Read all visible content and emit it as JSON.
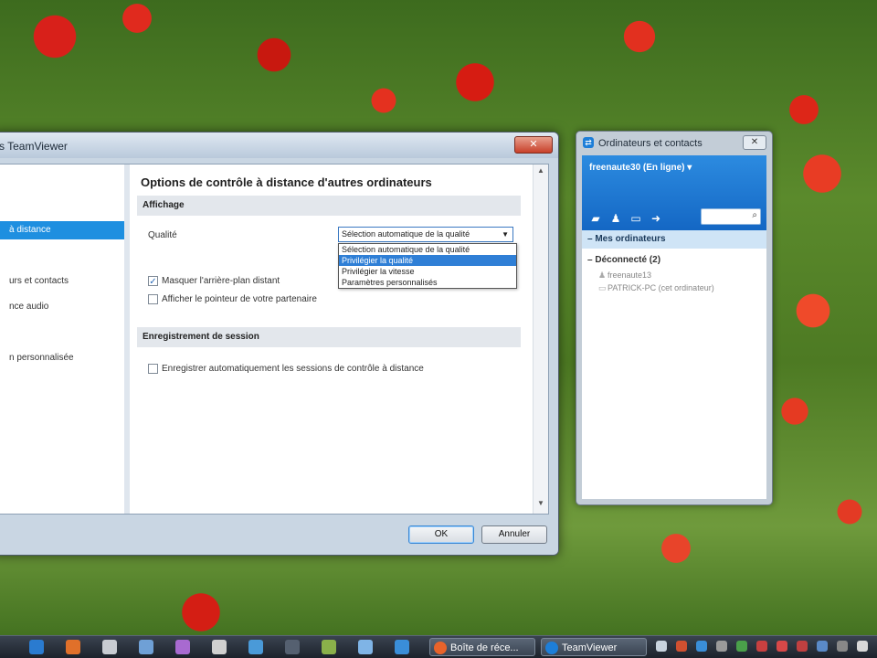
{
  "main_window": {
    "title": "s TeamViewer",
    "close_label": "✕",
    "nav": [
      {
        "label": "à distance",
        "selected": true
      },
      {
        "label": "urs et contacts",
        "selected": false
      },
      {
        "label": "nce audio",
        "selected": false
      },
      {
        "label": "n personnalisée",
        "selected": false
      }
    ],
    "page_title": "Options de contrôle à distance d'autres ordinateurs",
    "display_section": {
      "header": "Affichage",
      "quality_label": "Qualité",
      "quality_selected": "Sélection automatique de la qualité",
      "quality_options": [
        "Sélection automatique de la qualité",
        "Privilégier la qualité",
        "Privilégier la vitesse",
        "Paramètres personnalisés"
      ],
      "highlighted_option_index": 1,
      "hide_wallpaper": {
        "label": "Masquer l'arrière-plan distant",
        "checked": true
      },
      "show_pointer": {
        "label": "Afficher le pointeur de votre partenaire",
        "checked": false
      }
    },
    "session_section": {
      "header": "Enregistrement de session",
      "auto_record": {
        "label": "Enregistrer automatiquement les sessions de contrôle à distance",
        "checked": false
      }
    },
    "ok_label": "OK",
    "cancel_label": "Annuler"
  },
  "contacts_panel": {
    "title": "Ordinateurs et contacts",
    "user_status": "freenaute30 (En ligne)",
    "group_header": "Mes ordinateurs",
    "offline_group": "Déconnecté (2)",
    "contacts": [
      "freenaute13",
      "PATRICK-PC (cet ordinateur)"
    ]
  },
  "taskbar": {
    "tasks": [
      {
        "label": "Boîte de réce...",
        "color": "#e8632a"
      },
      {
        "label": "TeamViewer",
        "color": "#1d7ed8"
      }
    ]
  }
}
